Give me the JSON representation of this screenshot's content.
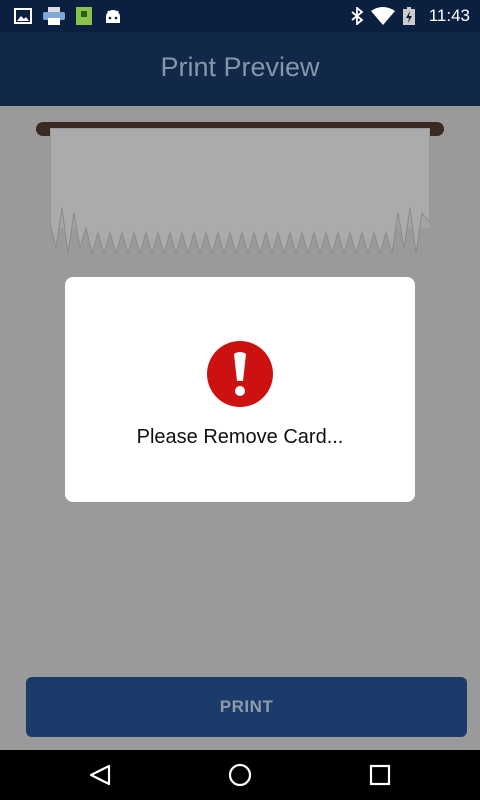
{
  "status_bar": {
    "time": "11:43",
    "left_icons": [
      "image-icon",
      "printer-icon",
      "sim-card-icon",
      "android-icon"
    ],
    "right_icons": [
      "bluetooth-icon",
      "wifi-icon",
      "battery-charging-icon"
    ]
  },
  "app_bar": {
    "title": "Print Preview"
  },
  "dialog": {
    "icon": "alert-icon",
    "icon_color": "#cc1111",
    "message": "Please Remove Card..."
  },
  "actions": {
    "print_label": "PRINT"
  },
  "nav_bar": {
    "buttons": [
      "back-icon",
      "home-icon",
      "recents-icon"
    ]
  },
  "colors": {
    "app_bar": "#112848",
    "button": "#1b3b6a",
    "overlay": "#9a9a9a"
  }
}
